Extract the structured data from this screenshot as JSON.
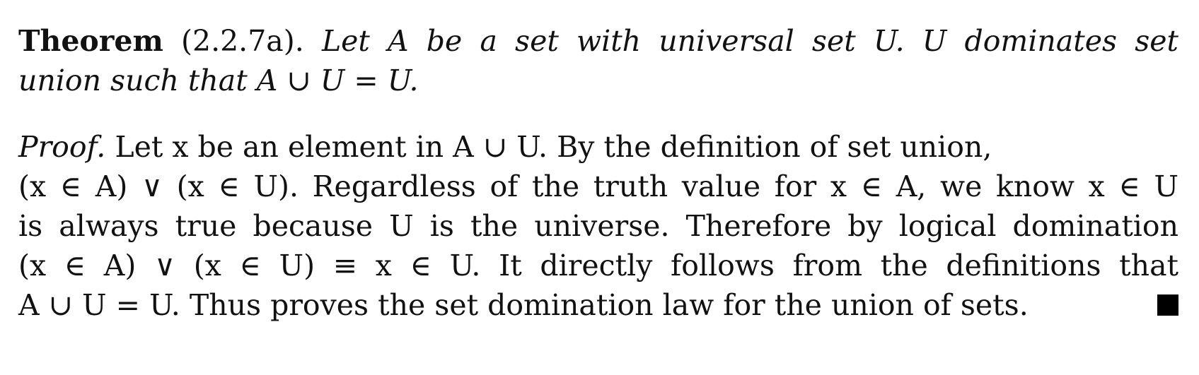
{
  "theorem": {
    "heading": "Theorem",
    "number": "(2.2.7a).",
    "lines": [
      "Let A be a set with universal set U. U dominates set",
      "union such that A ∪ U = U."
    ]
  },
  "proof": {
    "label": "Proof.",
    "lines": [
      "Let x be an element in A ∪ U. By the definition of set union,",
      "(x ∈ A) ∨ (x ∈ U). Regardless of the truth value for x ∈ A, we know x ∈ U",
      "is always true because U is the universe. Therefore by logical domination",
      "(x ∈ A) ∨ (x ∈ U) ≡ x ∈ U. It directly follows from the definitions that",
      "A ∪ U = U. Thus proves the set domination law for the union of sets."
    ],
    "qed_symbol": "■"
  }
}
